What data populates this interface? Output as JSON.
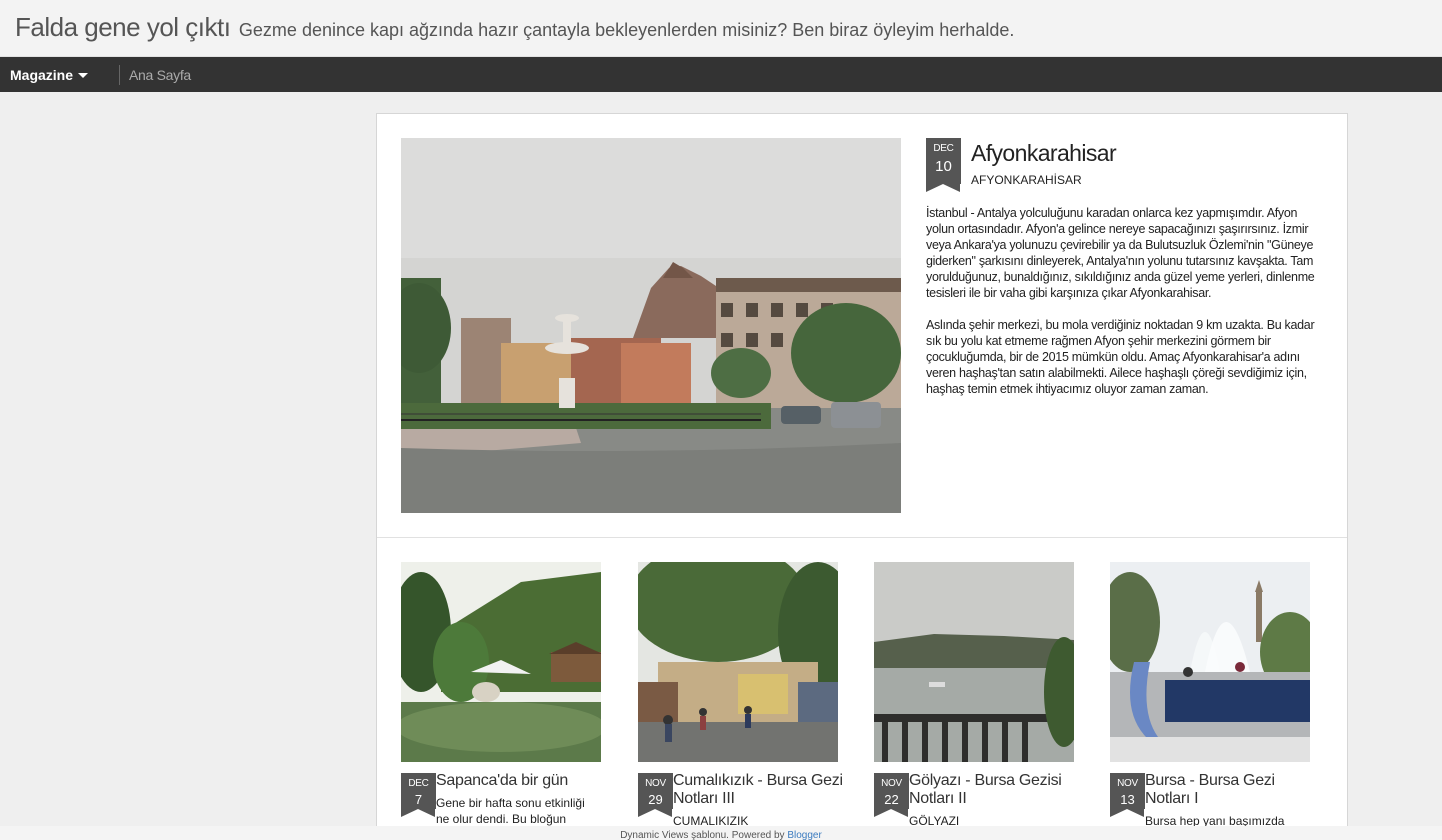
{
  "header": {
    "title": "Falda gene yol çıktı",
    "description": "Gezme denince kapı ağzında hazır çantayla bekleyenlerden misiniz? Ben biraz öyleyim herhalde."
  },
  "nav": {
    "view_label": "Magazine",
    "link_home": "Ana Sayfa"
  },
  "featured": {
    "month": "DEC",
    "day": "10",
    "title": "Afyonkarahisar",
    "label": "AFYONKARAHİSAR",
    "paragraphs": [
      "İstanbul - Antalya yolculuğunu karadan onlarca kez yapmışımdır. Afyon yolun ortasındadır. Afyon'a gelince nereye sapacağınızı şaşırırsınız. İzmir veya Ankara'ya yolunuzu çevirebilir ya da Bulutsuzluk Özlemi'nin \"Güneye giderken\" şarkısını dinleyerek, Antalya'nın yolunu tutarsınız kavşakta. Tam yorulduğunuz, bunaldığınız, sıkıldığınız anda güzel yeme yerleri, dinlenme tesisleri ile bir vaha gibi karşınıza çıkar Afyonkarahisar.",
      "Aslında şehir merkezi, bu mola verdiğiniz noktadan 9 km uzakta. Bu kadar sık bu yolu kat etmeme rağmen Afyon şehir merkezini görmem bir çocukluğumda, bir de 2015 mümkün oldu. Amaç Afyonkarahisar'a adını veren haşhaş'tan satın alabilmekti. Ailece haşhaşlı çöreği sevdiğimiz için, haşhaş temin etmek ihtiyacımız oluyor zaman zaman."
    ]
  },
  "posts": [
    {
      "month": "DEC",
      "day": "7",
      "title": "Sapanca'da bir gün",
      "snippet": "Gene bir hafta sonu etkinliği ne olur dendi. Bu bloğun"
    },
    {
      "month": "NOV",
      "day": "29",
      "title": "Cumalıkızık - Bursa Gezi Notları III",
      "label": "CUMALIKIZIK"
    },
    {
      "month": "NOV",
      "day": "22",
      "title": "Gölyazı - Bursa Gezisi Notları II",
      "label": "GÖLYAZI"
    },
    {
      "month": "NOV",
      "day": "13",
      "title": "Bursa - Bursa Gezi Notları I",
      "snippet": "Bursa hep yanı başımızda"
    }
  ],
  "footer": {
    "text": "Dynamic Views şablonu. Powered by",
    "link": "Blogger"
  },
  "colors": {
    "nav_bg": "#333333",
    "badge_bg": "#555555",
    "link": "#3b7bbf"
  }
}
